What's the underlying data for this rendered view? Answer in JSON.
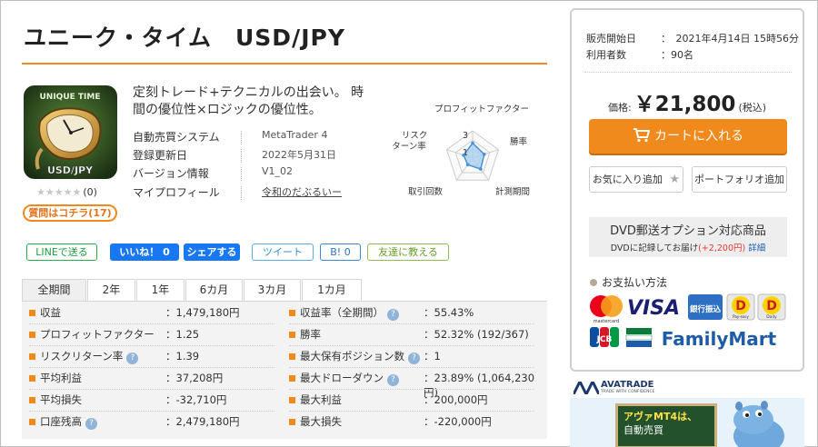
{
  "title": "ユニーク・タイム　USD/JPY",
  "product": {
    "icon_top_text": "UNIQUE TIME",
    "icon_bottom_text": "USD/JPY",
    "rating_stars": 0,
    "rating_text": "★★★★★",
    "rating_count": "(0)",
    "qa_button": "質問はコチラ(17)",
    "catchphrase": "定刻トレード+テクニカルの出会い。 時間の優位性×ロジックの優位性。",
    "specs": [
      {
        "label": "自動売買システム",
        "value": "MetaTrader 4"
      },
      {
        "label": "登録更新日",
        "value": "2022年5月31日"
      },
      {
        "label": "バージョン情報",
        "value": "V1_02"
      },
      {
        "label": "マイプロフィール",
        "value": "令和のだぶるいー"
      }
    ]
  },
  "radar": {
    "labels": [
      "プロフィットファクター",
      "勝率",
      "計測期間",
      "取引回数",
      "リスク",
      "ターン率"
    ],
    "scale_labels": [
      "3",
      "1"
    ],
    "values": [
      0.55,
      0.45,
      0.5,
      0.3,
      0.35
    ],
    "colors": {
      "fill": "#a9d1f0",
      "stroke": "#4a90d6",
      "grid": "#cccccc"
    }
  },
  "social": {
    "line": "LINEで送る",
    "like": "いいね！ 0",
    "share": "シェアする",
    "tweet": "ツイート",
    "hatena": "B! 0",
    "friend": "友達に教える"
  },
  "tabs": [
    "全期間",
    "2年",
    "1年",
    "6カ月",
    "3カ月",
    "1カ月"
  ],
  "active_tab": 0,
  "stats_left": [
    {
      "label": "収益",
      "value": "：1,479,180円",
      "help": false
    },
    {
      "label": "プロフィットファクター",
      "value": "：1.25",
      "help": false
    },
    {
      "label": "リスクリターン率",
      "value": "：1.39",
      "help": true
    },
    {
      "label": "平均利益",
      "value": "：37,208円",
      "help": false
    },
    {
      "label": "平均損失",
      "value": "：-32,710円",
      "help": false
    },
    {
      "label": "口座残高",
      "value": "：2,479,180円",
      "help": true
    }
  ],
  "stats_right": [
    {
      "label": "収益率（全期間）",
      "value": "：55.43%",
      "help": true
    },
    {
      "label": "勝率",
      "value": "：52.32% (192/367)",
      "help": false
    },
    {
      "label": "最大保有ポジション数",
      "value": "：1",
      "help": true
    },
    {
      "label": "最大ドローダウン",
      "value": "：23.89% (1,064,230円)",
      "help": true
    },
    {
      "label": "最大利益",
      "value": "：200,000円",
      "help": false
    },
    {
      "label": "最大損失",
      "value": "：-220,000円",
      "help": false
    }
  ],
  "help_glyph": "?",
  "panel": {
    "sale_start_label": "販売開始日",
    "sale_start_value": "：　2021年4月14日 15時56分",
    "users_label": "利用者数",
    "users_value": "：90名",
    "price_label": "価格:",
    "price_value": "￥21,800",
    "price_tax": "(税込)",
    "cart_button": "カートに入れる",
    "favorite_button": "お気に入り追加",
    "portfolio_button": "ポートフォリオ追加",
    "dvd_title": "DVD郵送オプション対応商品",
    "dvd_note": "DVDに記録してお届け",
    "dvd_price": "(+2,200円)",
    "dvd_link": "詳細",
    "payment_title": "お支払い方法",
    "payments": [
      "mastercard",
      "VISA",
      "銀行振込",
      "Pay-easy",
      "Daily",
      "JCB",
      "FamilyMart"
    ]
  },
  "ad": {
    "brand": "AVATRADE",
    "brand_sub": "TRADE WITH CONFIDENCE",
    "line1": "アヴァMT4は、",
    "line2": "自動売買"
  },
  "colors": {
    "accent": "#f08a1c",
    "facebook": "#1877f2",
    "line": "#22b14c",
    "twitter": "#55acee"
  }
}
